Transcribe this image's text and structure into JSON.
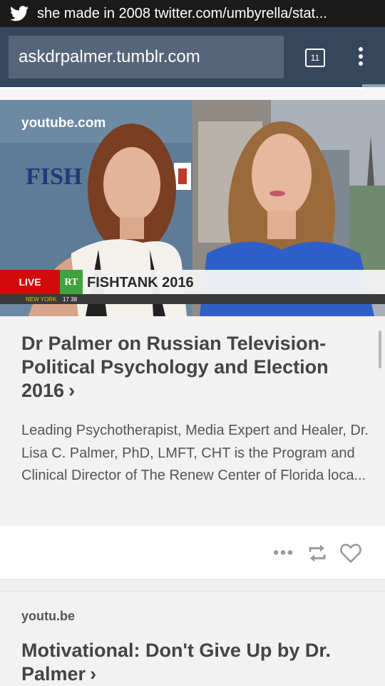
{
  "status_bar": {
    "notification_text": "she made in 2008 twitter.com/umbyrella/stat..."
  },
  "browser": {
    "url": "askdrpalmer.tumblr.com",
    "tab_count": "11"
  },
  "post1": {
    "video_source": "youtube.com",
    "video_overlay": {
      "live": "LIVE",
      "network": "RT",
      "show": "FISHTANK 2016",
      "location": "NEW YORK",
      "time": "17 38",
      "backdrop": "FISH"
    },
    "title": "Dr Palmer on Russian Television- Political Psychology and Election 2016",
    "excerpt": "Leading Psychotherapist, Media Expert and Healer, Dr. Lisa C. Palmer, PhD, LMFT, CHT is the Program and Clinical Director of The Renew Center of Florida loca..."
  },
  "post2": {
    "source": "youtu.be",
    "title": "Motivational: Don't Give Up by Dr. Palmer"
  },
  "colors": {
    "tumblr_navy": "#36465d",
    "url_field": "#56657a",
    "live_red": "#d10a0a",
    "rt_green": "#3fa33f"
  },
  "icons": [
    "twitter-icon",
    "tabs-icon",
    "overflow-menu-icon",
    "chevron-right-icon",
    "more-icon",
    "reblog-icon",
    "heart-icon"
  ]
}
